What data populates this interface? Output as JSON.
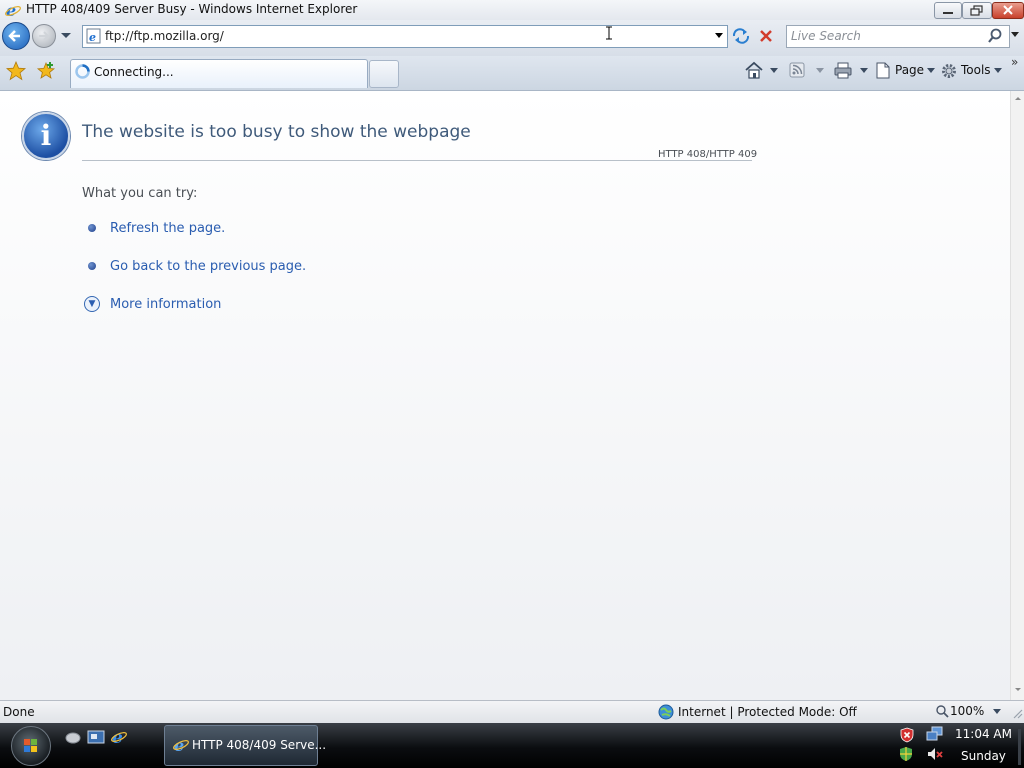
{
  "window": {
    "title": "HTTP 408/409 Server Busy - Windows Internet Explorer"
  },
  "address": {
    "url": "ftp://ftp.mozilla.org/"
  },
  "search": {
    "placeholder": "Live Search"
  },
  "tabs": [
    {
      "label": "Connecting..."
    }
  ],
  "command_bar": {
    "page_label": "Page",
    "tools_label": "Tools",
    "overflow": "»"
  },
  "content": {
    "heading": "The website is too busy to show the webpage",
    "error_code": "HTTP 408/HTTP 409",
    "try_label": "What you can try:",
    "links": [
      {
        "label": "Refresh the page."
      },
      {
        "label": "Go back to the previous page."
      },
      {
        "label": "More information"
      }
    ]
  },
  "status_bar": {
    "status": "Done",
    "zone": "Internet | Protected Mode: Off",
    "zoom": "100%"
  },
  "taskbar": {
    "active_window": "HTTP 408/409 Serve...",
    "time": "11:04 AM",
    "day": "Sunday"
  },
  "colors": {
    "link": "#2a5db0",
    "heading": "#3f5a7a",
    "info_icon": "#1d4fa3"
  }
}
